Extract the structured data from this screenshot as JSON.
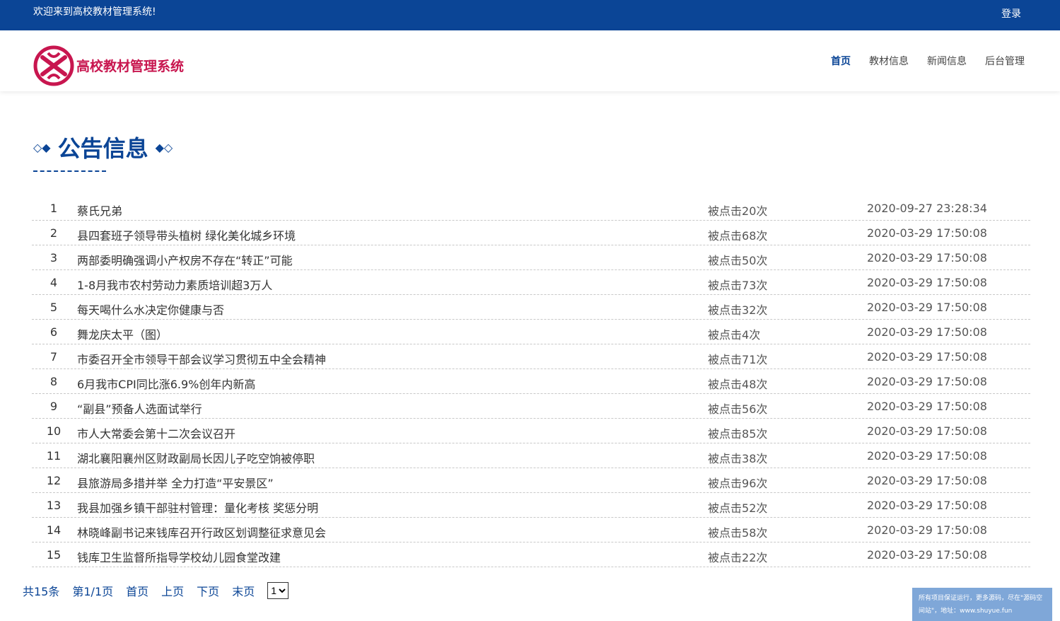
{
  "topbar": {
    "welcome": "欢迎来到高校教材管理系统!",
    "login": "登录"
  },
  "header": {
    "site_name": "高校教材管理系统",
    "nav": [
      "首页",
      "教材信息",
      "新闻信息",
      "后台管理"
    ]
  },
  "section": {
    "title": "公告信息",
    "diamonds_left": "◇◆",
    "diamonds_right": "◆◇"
  },
  "news": {
    "click_prefix": "被点击",
    "click_suffix": "次",
    "rows": [
      {
        "index": "1",
        "title": "蔡氏兄弟",
        "clicks": "20",
        "date": "2020-09-27 23:28:34"
      },
      {
        "index": "2",
        "title": "县四套班子领导带头植树 绿化美化城乡环境",
        "clicks": "68",
        "date": "2020-03-29 17:50:08"
      },
      {
        "index": "3",
        "title": "两部委明确强调小产权房不存在“转正”可能",
        "clicks": "50",
        "date": "2020-03-29 17:50:08"
      },
      {
        "index": "4",
        "title": "1-8月我市农村劳动力素质培训超3万人",
        "clicks": "73",
        "date": "2020-03-29 17:50:08"
      },
      {
        "index": "5",
        "title": "每天喝什么水决定你健康与否",
        "clicks": "32",
        "date": "2020-03-29 17:50:08"
      },
      {
        "index": "6",
        "title": "舞龙庆太平（图）",
        "clicks": "4",
        "date": "2020-03-29 17:50:08"
      },
      {
        "index": "7",
        "title": "市委召开全市领导干部会议学习贯彻五中全会精神",
        "clicks": "71",
        "date": "2020-03-29 17:50:08"
      },
      {
        "index": "8",
        "title": "6月我市CPI同比涨6.9%创年内新高",
        "clicks": "48",
        "date": "2020-03-29 17:50:08"
      },
      {
        "index": "9",
        "title": "“副县”预备人选面试举行",
        "clicks": "56",
        "date": "2020-03-29 17:50:08"
      },
      {
        "index": "10",
        "title": "市人大常委会第十二次会议召开",
        "clicks": "85",
        "date": "2020-03-29 17:50:08"
      },
      {
        "index": "11",
        "title": "湖北襄阳襄州区财政副局长因儿子吃空饷被停职",
        "clicks": "38",
        "date": "2020-03-29 17:50:08"
      },
      {
        "index": "12",
        "title": "县旅游局多措并举 全力打造“平安景区”",
        "clicks": "96",
        "date": "2020-03-29 17:50:08"
      },
      {
        "index": "13",
        "title": "我县加强乡镇干部驻村管理：量化考核 奖惩分明",
        "clicks": "52",
        "date": "2020-03-29 17:50:08"
      },
      {
        "index": "14",
        "title": "林晓峰副书记来钱库召开行政区划调整征求意见会",
        "clicks": "58",
        "date": "2020-03-29 17:50:08"
      },
      {
        "index": "15",
        "title": "钱库卫生监督所指导学校幼儿园食堂改建",
        "clicks": "22",
        "date": "2020-03-29 17:50:08"
      }
    ]
  },
  "pager": {
    "total": "共15条",
    "page_info": "第1/1页",
    "first": "首页",
    "prev": "上页",
    "next": "下页",
    "last": "末页",
    "selected": "1"
  },
  "watermark": {
    "text": "所有项目保证运行，更多源码，尽在\"源码空间站\"，地址：www.shuyue.fun"
  },
  "colors": {
    "brand_blue": "#0b4596",
    "logo_red": "#c8164f"
  }
}
